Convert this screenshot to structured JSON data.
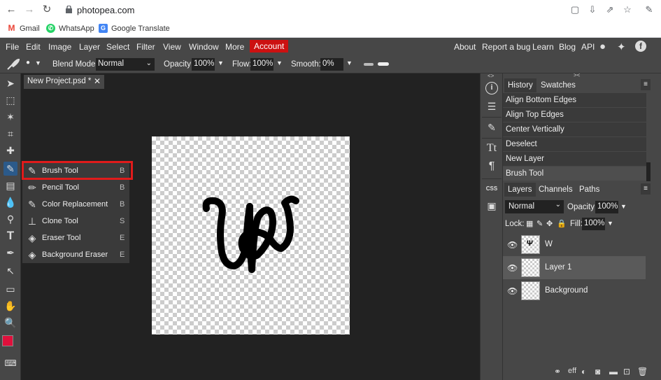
{
  "browser": {
    "url": "photopea.com",
    "bookmarks": [
      "Gmail",
      "WhatsApp",
      "Google Translate"
    ]
  },
  "menu": {
    "items": [
      "File",
      "Edit",
      "Image",
      "Layer",
      "Select",
      "Filter",
      "View",
      "Window",
      "More"
    ],
    "account": "Account",
    "right_items": [
      "About",
      "Report a bug",
      "Learn",
      "Blog",
      "API"
    ]
  },
  "options": {
    "blend_mode_label": "Blend Mode:",
    "blend_mode_value": "Normal",
    "opacity_label": "Opacity:",
    "opacity_value": "100%",
    "flow_label": "Flow:",
    "flow_value": "100%",
    "smooth_label": "Smooth:",
    "smooth_value": "0%"
  },
  "document": {
    "tab_title": "New Project.psd *",
    "close_glyph": "✕"
  },
  "flyout": {
    "items": [
      {
        "label": "Brush Tool",
        "key": "B",
        "icon": "brush-icon"
      },
      {
        "label": "Pencil Tool",
        "key": "B",
        "icon": "pencil-icon"
      },
      {
        "label": "Color Replacement",
        "key": "B",
        "icon": "color-replace-icon"
      },
      {
        "label": "Clone Tool",
        "key": "S",
        "icon": "clone-stamp-icon"
      },
      {
        "label": "Eraser Tool",
        "key": "E",
        "icon": "eraser-icon"
      },
      {
        "label": "Background Eraser",
        "key": "E",
        "icon": "background-eraser-icon"
      }
    ]
  },
  "history": {
    "tabs": [
      "History",
      "Swatches"
    ],
    "items": [
      "Align Bottom Edges",
      "Align Top Edges",
      "Center Vertically",
      "Deselect",
      "New Layer",
      "Brush Tool"
    ]
  },
  "layers": {
    "tabs": [
      "Layers",
      "Channels",
      "Paths"
    ],
    "blend_value": "Normal",
    "opacity_label": "Opacity:",
    "opacity_value": "100%",
    "lock_label": "Lock:",
    "fill_label": "Fill:",
    "fill_value": "100%",
    "items": [
      {
        "name": "W",
        "selected": false
      },
      {
        "name": "Layer 1",
        "selected": true
      },
      {
        "name": "Background",
        "selected": false
      }
    ],
    "bottom_icons": [
      "link-icon",
      "effects-icon",
      "adjustment-icon",
      "mask-icon",
      "folder-icon",
      "new-layer-icon",
      "trash-icon"
    ],
    "effects_text": "eff"
  },
  "colors": {
    "foreground": "#e0103c",
    "background": "#000000",
    "accent": "#cc1111"
  }
}
